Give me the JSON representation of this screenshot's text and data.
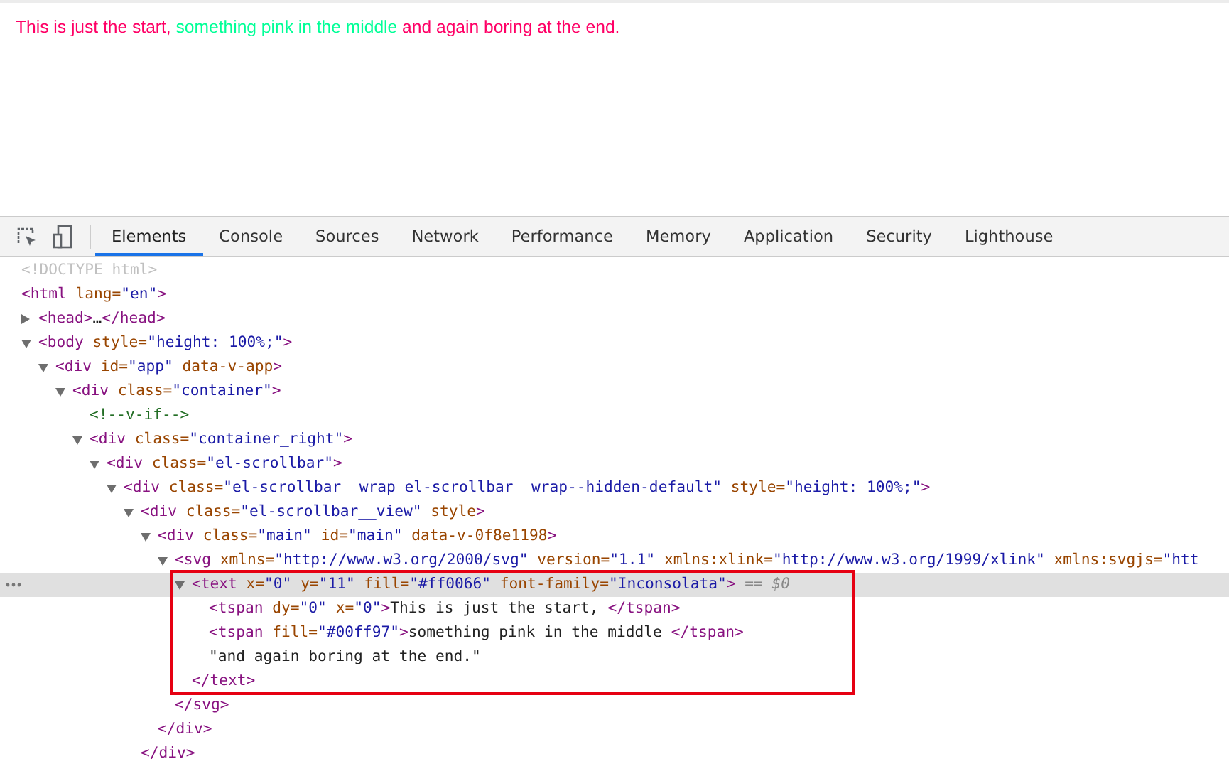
{
  "preview": {
    "segments": [
      {
        "text": "This is just the start, ",
        "color": "#ff0066"
      },
      {
        "text": "something pink in the middle",
        "color": "#00ff97"
      },
      {
        "text": " and again boring at the end.",
        "color": "#ff0066"
      }
    ]
  },
  "toolbar": {
    "tabs": [
      {
        "label": "Elements",
        "selected": true
      },
      {
        "label": "Console",
        "selected": false
      },
      {
        "label": "Sources",
        "selected": false
      },
      {
        "label": "Network",
        "selected": false
      },
      {
        "label": "Performance",
        "selected": false
      },
      {
        "label": "Memory",
        "selected": false
      },
      {
        "label": "Application",
        "selected": false
      },
      {
        "label": "Security",
        "selected": false
      },
      {
        "label": "Lighthouse",
        "selected": false
      }
    ]
  },
  "dom_tree": [
    {
      "tokens": [
        {
          "kind": "doctype",
          "text": "<!DOCTYPE html>"
        }
      ]
    },
    {
      "tokens": [
        {
          "kind": "tag",
          "text": "<html "
        },
        {
          "kind": "name",
          "text": "lang="
        },
        {
          "kind": "value",
          "text": "\"en\""
        },
        {
          "kind": "tag",
          "text": ">"
        }
      ],
      "children": [
        {
          "expanded": false,
          "tokens": [
            {
              "kind": "tag",
              "text": "<head>"
            },
            {
              "kind": "text",
              "text": "…"
            },
            {
              "kind": "tag",
              "text": "</head>"
            }
          ]
        },
        {
          "expanded": true,
          "tokens": [
            {
              "kind": "tag",
              "text": "<body "
            },
            {
              "kind": "name",
              "text": "style="
            },
            {
              "kind": "value",
              "text": "\"height: 100%;\""
            },
            {
              "kind": "tag",
              "text": ">"
            }
          ],
          "children": [
            {
              "expanded": true,
              "tokens": [
                {
                  "kind": "tag",
                  "text": "<div "
                },
                {
                  "kind": "name",
                  "text": "id="
                },
                {
                  "kind": "value",
                  "text": "\"app\""
                },
                {
                  "kind": "name",
                  "text": " data-v-app"
                },
                {
                  "kind": "tag",
                  "text": ">"
                }
              ],
              "children": [
                {
                  "expanded": true,
                  "tokens": [
                    {
                      "kind": "tag",
                      "text": "<div "
                    },
                    {
                      "kind": "name",
                      "text": "class="
                    },
                    {
                      "kind": "value",
                      "text": "\"container\""
                    },
                    {
                      "kind": "tag",
                      "text": ">"
                    }
                  ],
                  "children": [
                    {
                      "tokens": [
                        {
                          "kind": "comment",
                          "text": "<!--v-if-->"
                        }
                      ]
                    },
                    {
                      "expanded": true,
                      "tokens": [
                        {
                          "kind": "tag",
                          "text": "<div "
                        },
                        {
                          "kind": "name",
                          "text": "class="
                        },
                        {
                          "kind": "value",
                          "text": "\"container_right\""
                        },
                        {
                          "kind": "tag",
                          "text": ">"
                        }
                      ],
                      "children": [
                        {
                          "expanded": true,
                          "tokens": [
                            {
                              "kind": "tag",
                              "text": "<div "
                            },
                            {
                              "kind": "name",
                              "text": "class="
                            },
                            {
                              "kind": "value",
                              "text": "\"el-scrollbar\""
                            },
                            {
                              "kind": "tag",
                              "text": ">"
                            }
                          ],
                          "children": [
                            {
                              "expanded": true,
                              "tokens": [
                                {
                                  "kind": "tag",
                                  "text": "<div "
                                },
                                {
                                  "kind": "name",
                                  "text": "class="
                                },
                                {
                                  "kind": "value",
                                  "text": "\"el-scrollbar__wrap el-scrollbar__wrap--hidden-default\""
                                },
                                {
                                  "kind": "name",
                                  "text": " style="
                                },
                                {
                                  "kind": "value",
                                  "text": "\"height: 100%;\""
                                },
                                {
                                  "kind": "tag",
                                  "text": ">"
                                }
                              ],
                              "children": [
                                {
                                  "expanded": true,
                                  "tokens": [
                                    {
                                      "kind": "tag",
                                      "text": "<div "
                                    },
                                    {
                                      "kind": "name",
                                      "text": "class="
                                    },
                                    {
                                      "kind": "value",
                                      "text": "\"el-scrollbar__view\""
                                    },
                                    {
                                      "kind": "name",
                                      "text": " style"
                                    },
                                    {
                                      "kind": "tag",
                                      "text": ">"
                                    }
                                  ],
                                  "closing": [
                                    {
                                      "kind": "tag",
                                      "text": "</div>"
                                    }
                                  ],
                                  "children": [
                                    {
                                      "expanded": true,
                                      "tokens": [
                                        {
                                          "kind": "tag",
                                          "text": "<div "
                                        },
                                        {
                                          "kind": "name",
                                          "text": "class="
                                        },
                                        {
                                          "kind": "value",
                                          "text": "\"main\""
                                        },
                                        {
                                          "kind": "name",
                                          "text": " id="
                                        },
                                        {
                                          "kind": "value",
                                          "text": "\"main\""
                                        },
                                        {
                                          "kind": "name",
                                          "text": " data-v-0f8e1198"
                                        },
                                        {
                                          "kind": "tag",
                                          "text": ">"
                                        }
                                      ],
                                      "closing": [
                                        {
                                          "kind": "tag",
                                          "text": "</div>"
                                        }
                                      ],
                                      "children": [
                                        {
                                          "expanded": true,
                                          "tokens": [
                                            {
                                              "kind": "tag",
                                              "text": "<svg "
                                            },
                                            {
                                              "kind": "name",
                                              "text": "xmlns="
                                            },
                                            {
                                              "kind": "value",
                                              "text": "\"http://www.w3.org/2000/svg\""
                                            },
                                            {
                                              "kind": "name",
                                              "text": " version="
                                            },
                                            {
                                              "kind": "value",
                                              "text": "\"1.1\""
                                            },
                                            {
                                              "kind": "name",
                                              "text": " xmlns:xlink="
                                            },
                                            {
                                              "kind": "value",
                                              "text": "\"http://www.w3.org/1999/xlink\""
                                            },
                                            {
                                              "kind": "name",
                                              "text": " xmlns:svgjs="
                                            },
                                            {
                                              "kind": "value",
                                              "text": "\"htt"
                                            }
                                          ],
                                          "closing": [
                                            {
                                              "kind": "tag",
                                              "text": "</svg>"
                                            }
                                          ],
                                          "children": [
                                            {
                                              "expanded": true,
                                              "selected": true,
                                              "annotated": true,
                                              "tokens": [
                                                {
                                                  "kind": "tag",
                                                  "text": "<text "
                                                },
                                                {
                                                  "kind": "name",
                                                  "text": "x="
                                                },
                                                {
                                                  "kind": "value",
                                                  "text": "\"0\""
                                                },
                                                {
                                                  "kind": "name",
                                                  "text": " y="
                                                },
                                                {
                                                  "kind": "value",
                                                  "text": "\"11\""
                                                },
                                                {
                                                  "kind": "name",
                                                  "text": " fill="
                                                },
                                                {
                                                  "kind": "value",
                                                  "text": "\"#ff0066\""
                                                },
                                                {
                                                  "kind": "name",
                                                  "text": " font-family="
                                                },
                                                {
                                                  "kind": "value",
                                                  "text": "\"Inconsolata\""
                                                },
                                                {
                                                  "kind": "tag",
                                                  "text": ">"
                                                },
                                                {
                                                  "kind": "hint",
                                                  "text": " == $0"
                                                }
                                              ],
                                              "closing": [
                                                {
                                                  "kind": "tag",
                                                  "text": "</text>"
                                                }
                                              ],
                                              "children": [
                                                {
                                                  "tokens": [
                                                    {
                                                      "kind": "tag",
                                                      "text": "<tspan "
                                                    },
                                                    {
                                                      "kind": "name",
                                                      "text": "dy="
                                                    },
                                                    {
                                                      "kind": "value",
                                                      "text": "\"0\""
                                                    },
                                                    {
                                                      "kind": "name",
                                                      "text": " x="
                                                    },
                                                    {
                                                      "kind": "value",
                                                      "text": "\"0\""
                                                    },
                                                    {
                                                      "kind": "tag",
                                                      "text": ">"
                                                    },
                                                    {
                                                      "kind": "text",
                                                      "text": "This is just the start, "
                                                    },
                                                    {
                                                      "kind": "tag",
                                                      "text": "</tspan>"
                                                    }
                                                  ]
                                                },
                                                {
                                                  "tokens": [
                                                    {
                                                      "kind": "tag",
                                                      "text": "<tspan "
                                                    },
                                                    {
                                                      "kind": "name",
                                                      "text": "fill="
                                                    },
                                                    {
                                                      "kind": "value",
                                                      "text": "\"#00ff97\""
                                                    },
                                                    {
                                                      "kind": "tag",
                                                      "text": ">"
                                                    },
                                                    {
                                                      "kind": "text",
                                                      "text": "something pink in the middle "
                                                    },
                                                    {
                                                      "kind": "tag",
                                                      "text": "</tspan>"
                                                    }
                                                  ]
                                                },
                                                {
                                                  "tokens": [
                                                    {
                                                      "kind": "text",
                                                      "text": "\"and again boring at the end.\""
                                                    }
                                                  ]
                                                }
                                              ]
                                            }
                                          ]
                                        }
                                      ]
                                    }
                                  ]
                                }
                              ]
                            }
                          ]
                        }
                      ]
                    }
                  ]
                }
              ]
            }
          ]
        }
      ]
    }
  ]
}
